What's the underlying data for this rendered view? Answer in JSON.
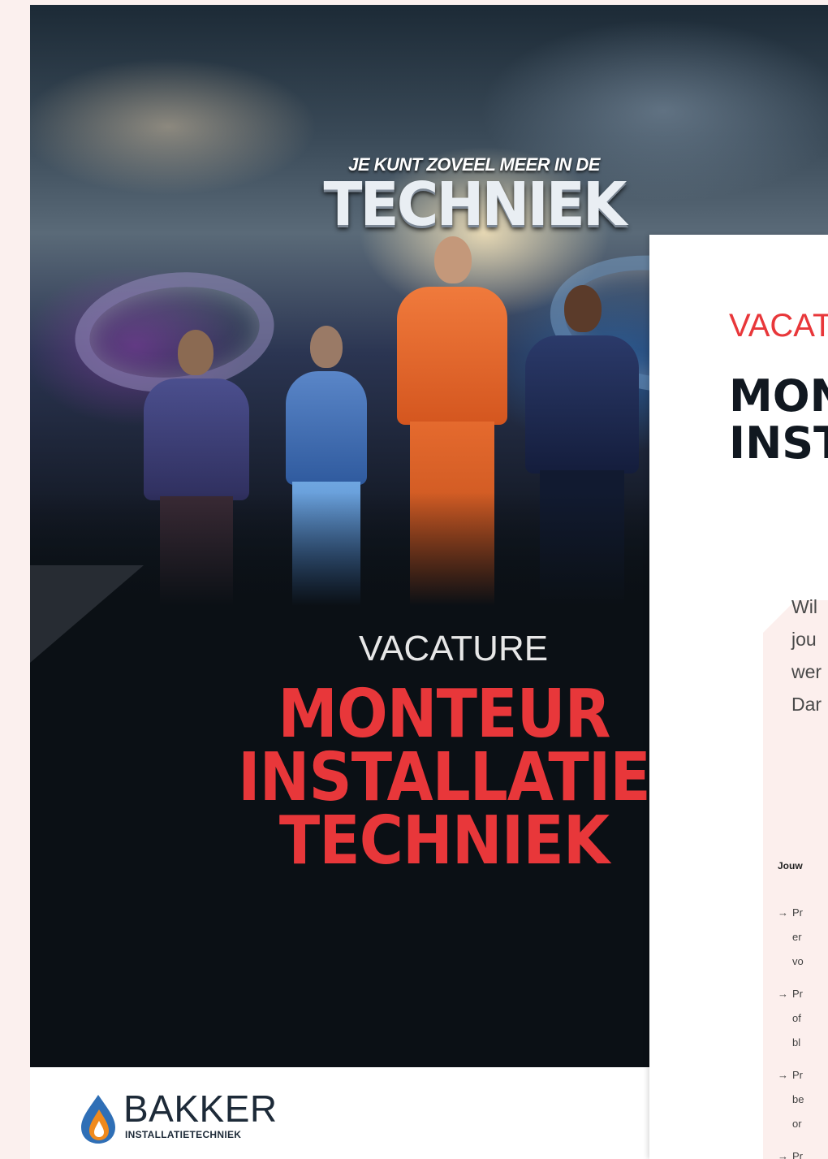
{
  "front": {
    "slogan_line1": "JE KUNT ZOVEEL MEER IN DE",
    "slogan_line2": "TECHNIEK",
    "vacature": "VACATURE",
    "title_lines": [
      "MONTEUR",
      "INSTALLATIE",
      "TECHNIEK"
    ],
    "logo": {
      "name": "BAKKER",
      "subtitle": "INSTALLATIETECHNIEK"
    }
  },
  "page2": {
    "vacature": "VACAT",
    "title_lines": [
      "MON",
      "INST"
    ],
    "intro_lines": [
      "Wil",
      "jou",
      "wer",
      "Dar"
    ],
    "small_heading": "Jouw",
    "bullets": [
      [
        "Pr",
        "er",
        "vo"
      ],
      [
        "Pr",
        "of",
        "bl"
      ],
      [
        "Pr",
        "be",
        "or"
      ],
      [
        "Pr"
      ]
    ]
  },
  "colors": {
    "accent_red": "#e8373a",
    "dark_band": "#0b1015",
    "page_background": "#fbf0ee",
    "logo_blue": "#2f6fb6",
    "logo_orange": "#f08a1d"
  }
}
